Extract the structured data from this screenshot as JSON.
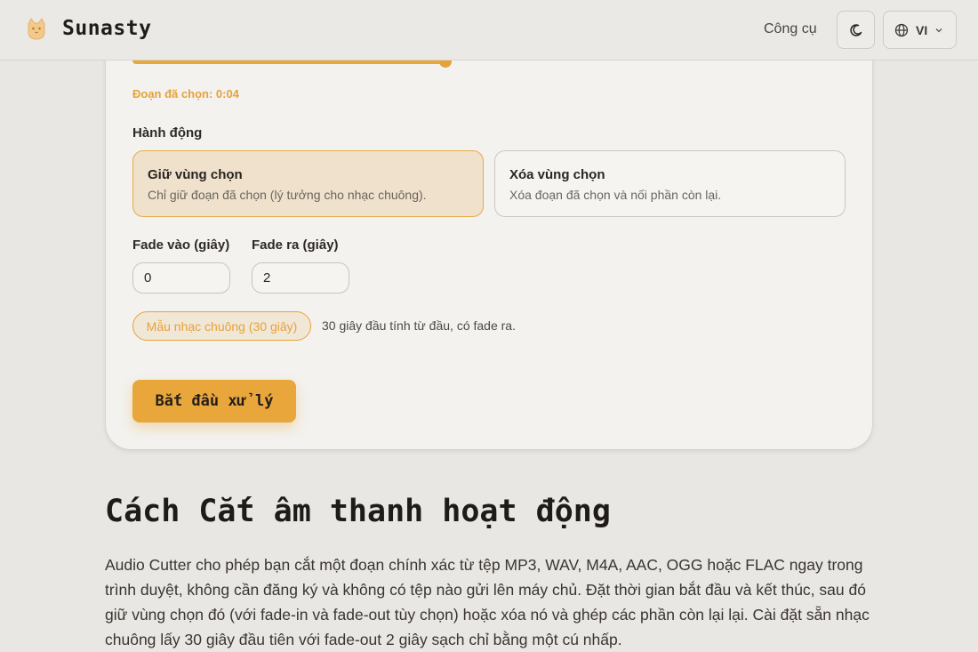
{
  "header": {
    "brand": "Sunasty",
    "nav_tools": "Công cụ",
    "theme_icon": "moon-icon",
    "lang_icon": "globe-icon",
    "lang": "VI"
  },
  "editor": {
    "selected_label": "Đoạn đã chọn: 0:04",
    "action_title": "Hành động",
    "options": [
      {
        "title": "Giữ vùng chọn",
        "desc": "Chỉ giữ đoạn đã chọn (lý tưởng cho nhạc chuông).",
        "selected": true
      },
      {
        "title": "Xóa vùng chọn",
        "desc": "Xóa đoạn đã chọn và nối phần còn lại.",
        "selected": false
      }
    ],
    "fade_in_label": "Fade vào (giây)",
    "fade_in_value": "0",
    "fade_out_label": "Fade ra (giây)",
    "fade_out_value": "2",
    "preset_label": "Mẫu nhạc chuông (30 giây)",
    "preset_hint": "30 giây đầu tính từ đầu, có fade ra.",
    "start_button": "Bắt đầu xử lý"
  },
  "section": {
    "heading": "Cách Cắt âm thanh hoạt động",
    "body": "Audio Cutter cho phép bạn cắt một đoạn chính xác từ tệp MP3, WAV, M4A, AAC, OGG hoặc FLAC ngay trong trình duyệt, không cần đăng ký và không có tệp nào gửi lên máy chủ. Đặt thời gian bắt đầu và kết thúc, sau đó giữ vùng chọn đó (với fade-in và fade-out tùy chọn) hoặc xóa nó và ghép các phần còn lại lại. Cài đặt sẵn nhạc chuông lấy 30 giây đầu tiên với fade-out 2 giây sạch chỉ bằng một cú nhấp."
  },
  "colors": {
    "accent": "#e6a23a",
    "background": "#e9e7e3",
    "card": "#f3f2ef"
  }
}
